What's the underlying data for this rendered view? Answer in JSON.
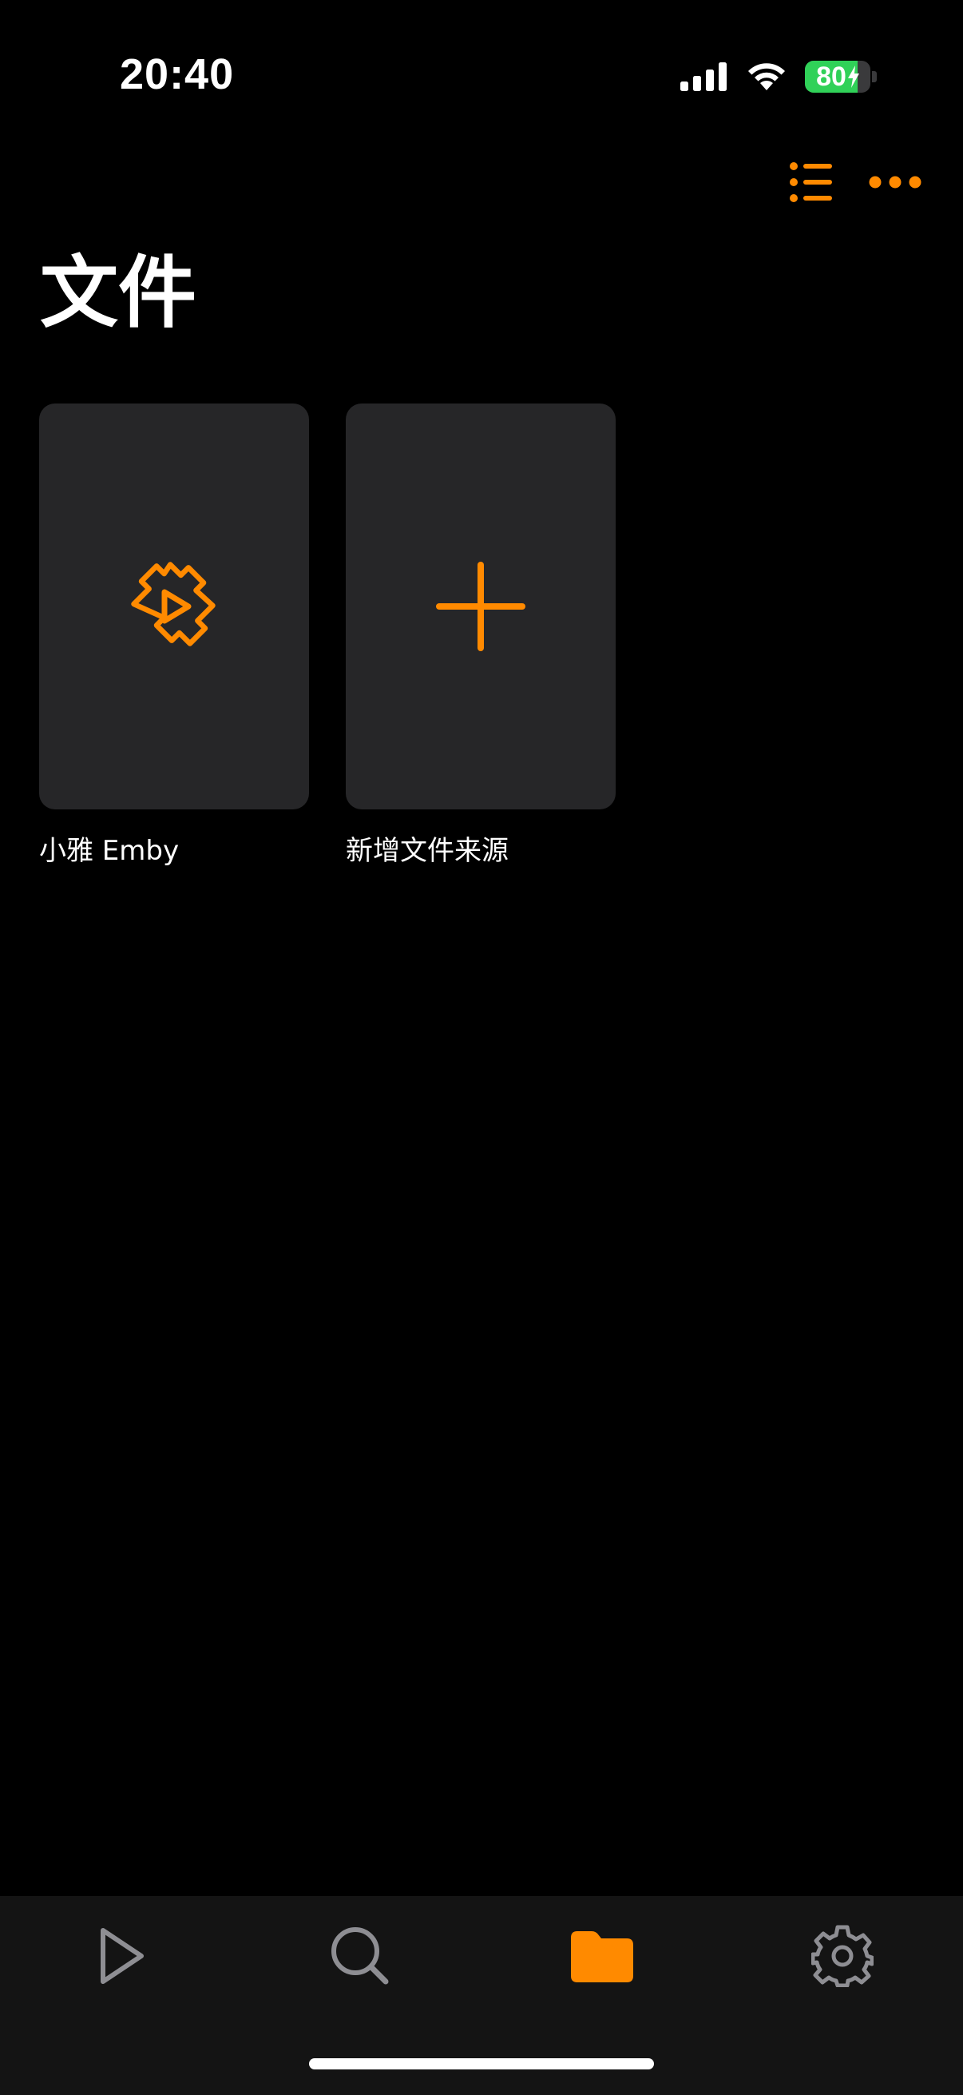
{
  "status_bar": {
    "time": "20:40",
    "battery_level": 80,
    "battery_text": "80",
    "charging": true
  },
  "header": {
    "title": "文件",
    "actions": [
      {
        "icon": "list-icon"
      },
      {
        "icon": "more-icon"
      }
    ]
  },
  "sources": [
    {
      "label": "小雅 Emby",
      "icon": "emby-icon"
    },
    {
      "label": "新增文件来源",
      "icon": "plus-icon"
    }
  ],
  "tab_bar": {
    "tabs": [
      {
        "icon": "play-icon",
        "active": false
      },
      {
        "icon": "search-icon",
        "active": false
      },
      {
        "icon": "folder-icon",
        "active": true
      },
      {
        "icon": "gear-icon",
        "active": false
      }
    ]
  },
  "colors": {
    "accent": "#FF8A00",
    "background": "#000000",
    "card": "#262628",
    "tab_bar": "#141414",
    "inactive_icon": "#8E8E93",
    "battery_green": "#30D158"
  }
}
